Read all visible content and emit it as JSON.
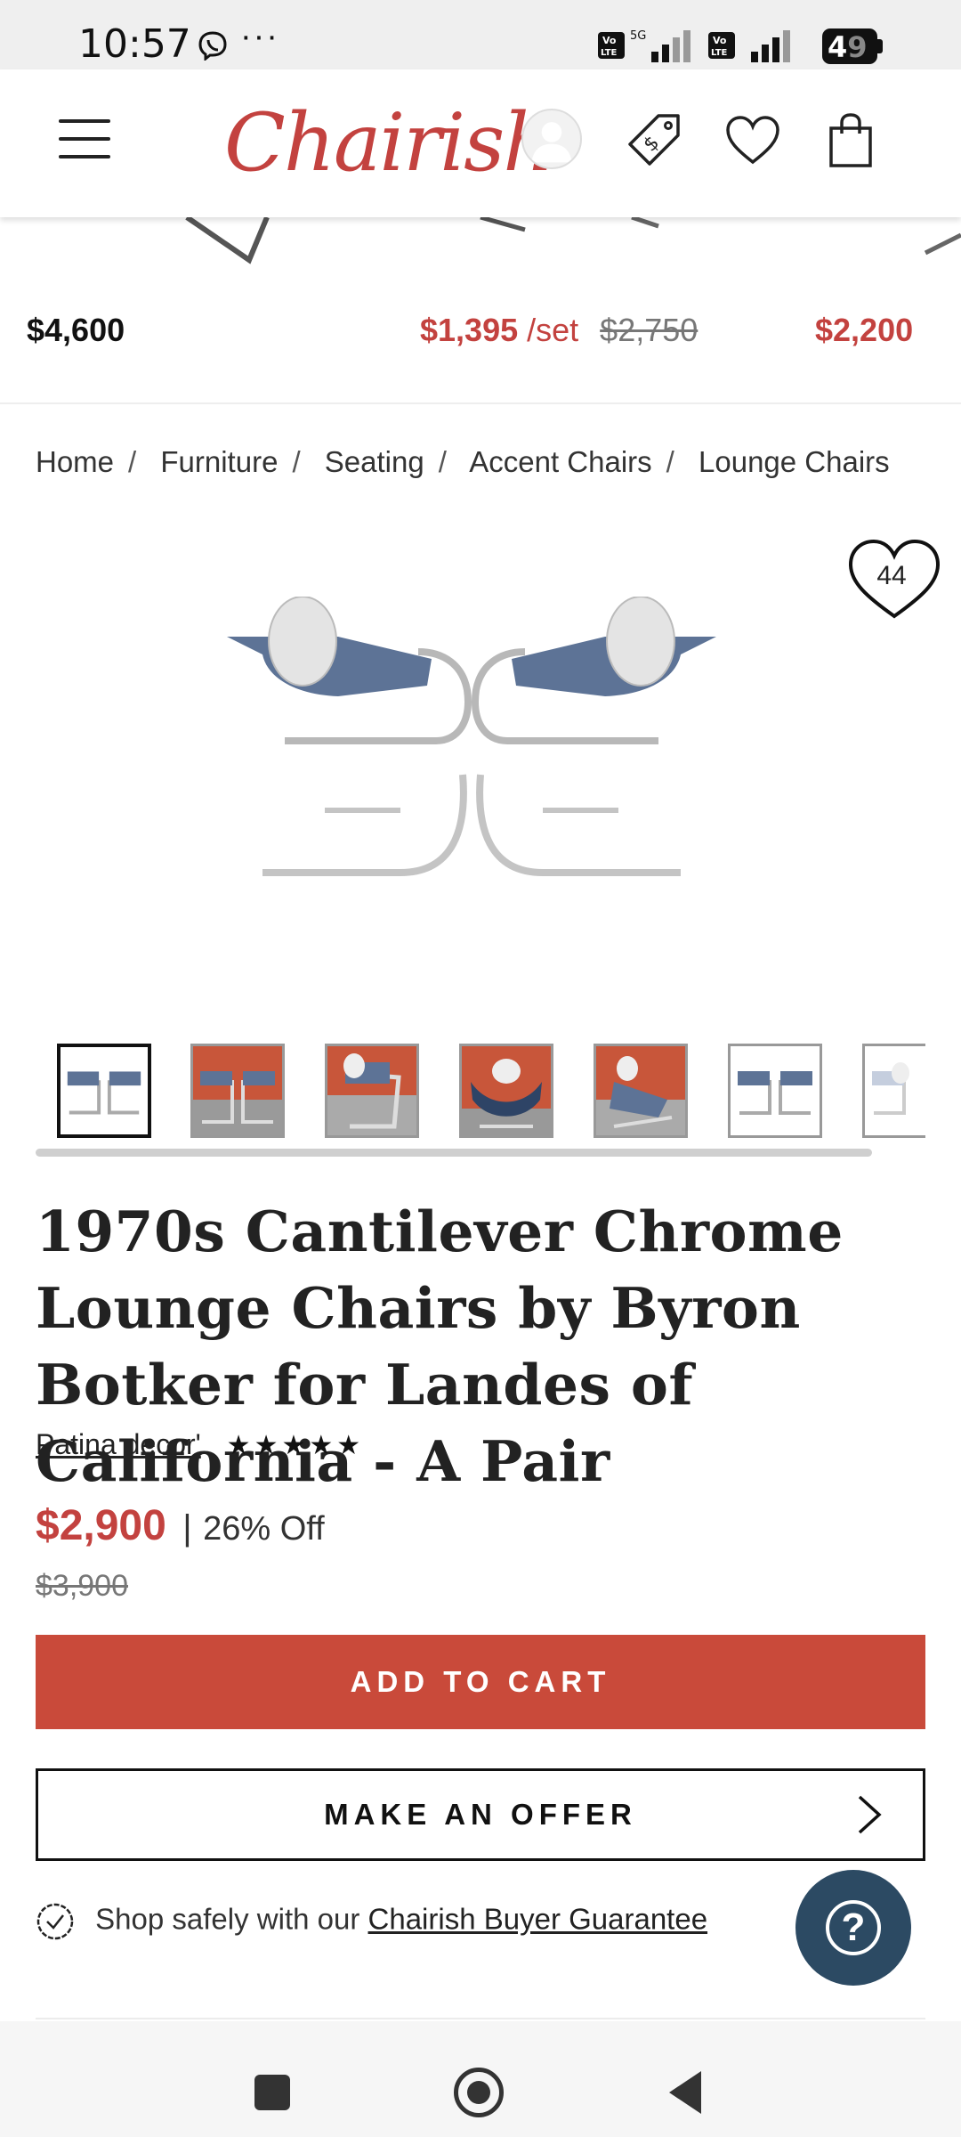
{
  "status_bar": {
    "time": "10:57",
    "dots": "···",
    "battery": "49"
  },
  "header": {
    "logo": "Chairish"
  },
  "strip": {
    "items": [
      {
        "price": "$4,600"
      },
      {
        "price": "$1,395",
        "unit": "/set",
        "old_price": "$2,750"
      },
      {
        "price": "$2,200"
      }
    ]
  },
  "breadcrumb": [
    "Home",
    "Furniture",
    "Seating",
    "Accent Chairs",
    "Lounge Chairs"
  ],
  "favorite": {
    "count": "44"
  },
  "thumbnails": {
    "count": 7,
    "selected_index": 0
  },
  "product": {
    "title": "1970s Cantilever Chrome Lounge Chairs by Byron Botker for Landes of California - A Pair",
    "seller": "Patina decor'",
    "rating_stars": "★★★★★",
    "price": "$2,900",
    "price_separator": "|",
    "discount": "26% Off",
    "original_price": "$3,900"
  },
  "actions": {
    "add_to_cart": "ADD TO CART",
    "make_offer": "MAKE AN OFFER"
  },
  "guarantee": {
    "text": "Shop safely with our",
    "link": "Chairish Buyer Guarantee"
  },
  "help": {
    "label": "?"
  },
  "colors": {
    "brand": "#c3423f",
    "cta": "#c94a3a",
    "help": "#2c4a63"
  },
  "icons": {
    "header": [
      "menu-icon",
      "user-icon",
      "price-tag-icon",
      "heart-icon",
      "shopping-bag-icon"
    ],
    "nav": [
      "recent-apps-icon",
      "home-icon",
      "back-icon"
    ]
  }
}
